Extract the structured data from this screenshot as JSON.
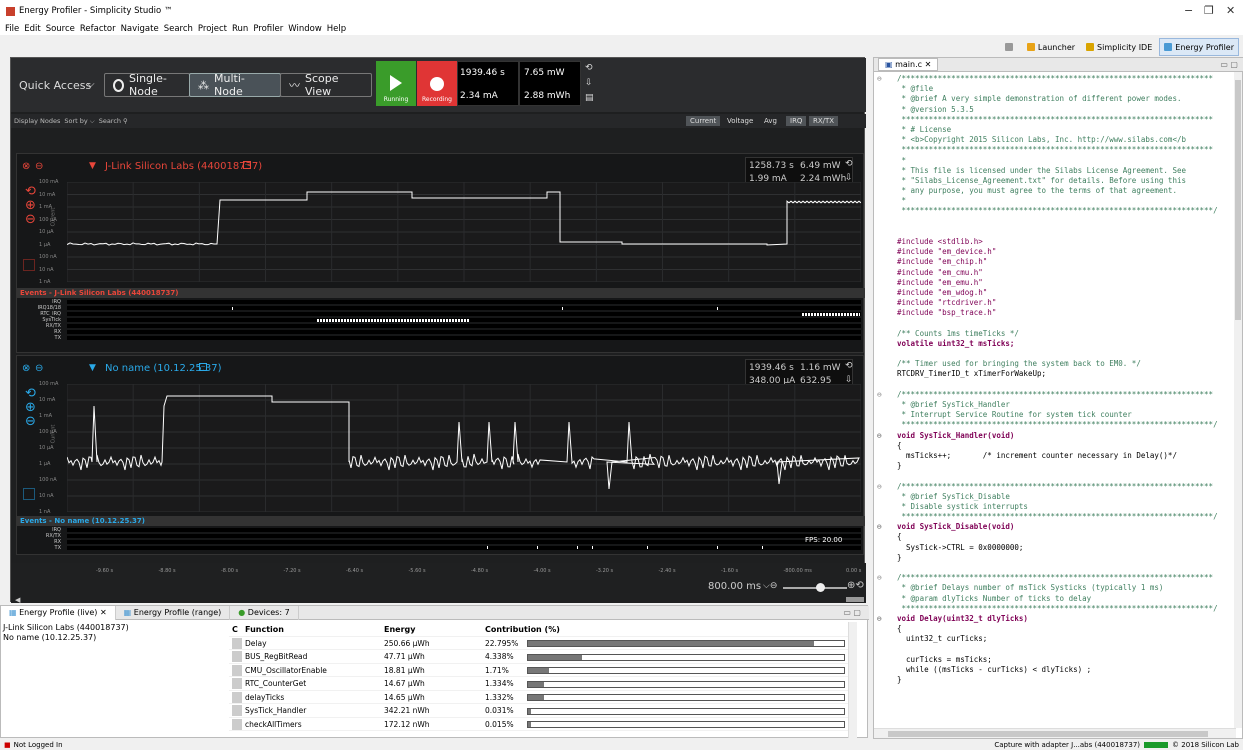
{
  "window": {
    "title": "Energy Profiler - Simplicity Studio ™",
    "min": "−",
    "max": "❐",
    "close": "✕"
  },
  "menu": [
    "File",
    "Edit",
    "Source",
    "Refactor",
    "Navigate",
    "Search",
    "Project",
    "Run",
    "Profiler",
    "Window",
    "Help"
  ],
  "perspectives": {
    "launcher": "Launcher",
    "ide": "Simplicity IDE",
    "profiler": "Energy Profiler"
  },
  "quick_access": {
    "label": "Quick Access",
    "single": "Single-Node",
    "multi": "Multi-Node",
    "scope": "Scope View"
  },
  "run": {
    "running": "Running",
    "recording": "Recording"
  },
  "stats": {
    "time": "1939.46 s",
    "current": "2.34 mA",
    "power": "7.65 mW",
    "energy": "2.88 mWh"
  },
  "filter": {
    "display": "Display Nodes",
    "sort": "Sort by",
    "search": "Search",
    "current": "Current",
    "voltage": "Voltage",
    "avg": "Avg",
    "irq": "IRQ",
    "rxtx": "RX/TX"
  },
  "node1": {
    "name": "J-Link Silicon Labs (440018737)",
    "time": "1258.73 s",
    "current": "1.99 mA",
    "power": "6.49 mW",
    "energy": "2.24 mWh",
    "events_label": "Events - J-Link Silicon Labs (440018737)",
    "ylabels": [
      "100 mA",
      "10 mA",
      "1 mA",
      "100 μA",
      "10 μA",
      "1 μA",
      "100 nA",
      "10 nA",
      "1 nA"
    ],
    "ytitle": "Current",
    "evlabels": [
      "IRQ",
      "IRQ18/18",
      "RTC_IRQ",
      "SysTick",
      "RX/TX",
      "RX",
      "TX"
    ]
  },
  "node2": {
    "name": "No name (10.12.25.37)",
    "time": "1939.46 s",
    "current": "348.00 μA",
    "power": "1.16 mW",
    "energy": "632.95 μWh",
    "events_label": "Events - No name (10.12.25.37)",
    "ylabels": [
      "100 mA",
      "10 mA",
      "1 mA",
      "100 μA",
      "10 μA",
      "1 μA",
      "100 nA",
      "10 nA",
      "1 nA"
    ],
    "ytitle": "Current",
    "evlabels": [
      "IRQ",
      "RX/TX",
      "RX",
      "TX"
    ],
    "fps": "FPS: 20.00"
  },
  "timeaxis": {
    "ticks": [
      "-9.60 s",
      "-8.80 s",
      "-8.00 s",
      "-7.20 s",
      "-6.40 s",
      "-5.60 s",
      "-4.80 s",
      "-4.00 s",
      "-3.20 s",
      "-2.40 s",
      "-1.60 s",
      "-800.00 ms",
      "0.00 s"
    ],
    "zoom": "800.00 ms"
  },
  "bottom": {
    "tab_live": "Energy Profile (live)",
    "tab_range": "Energy Profile (range)",
    "tab_devices": "Devices: 7",
    "devices": [
      "J-Link Silicon Labs (440018737)",
      "No name (10.12.25.37)"
    ],
    "headers": {
      "c": "C",
      "function": "Function",
      "energy": "Energy",
      "contribution": "Contribution (%)"
    },
    "rows": [
      {
        "fn": "Delay",
        "energy": "250.66 μWh",
        "pct": "22.795%",
        "frac": 0.228
      },
      {
        "fn": "BUS_RegBitRead",
        "energy": "47.71 μWh",
        "pct": "4.338%",
        "frac": 0.043
      },
      {
        "fn": "CMU_OscillatorEnable",
        "energy": "18.81 μWh",
        "pct": "1.71%",
        "frac": 0.017
      },
      {
        "fn": "RTC_CounterGet",
        "energy": "14.67 μWh",
        "pct": "1.334%",
        "frac": 0.013
      },
      {
        "fn": "delayTicks",
        "energy": "14.65 μWh",
        "pct": "1.332%",
        "frac": 0.013
      },
      {
        "fn": "SysTick_Handler",
        "energy": "342.21 nWh",
        "pct": "0.031%",
        "frac": 0.0003
      },
      {
        "fn": "checkAllTimers",
        "energy": "172.12 nWh",
        "pct": "0.015%",
        "frac": 0.00015
      }
    ]
  },
  "editor": {
    "tab": "main.c",
    "lines": [
      {
        "t": "/*********************************************************************",
        "c": "cm",
        "f": "⊖"
      },
      {
        "t": " * @file",
        "c": "cm"
      },
      {
        "t": " * @brief A very simple demonstration of different power modes.",
        "c": "cm"
      },
      {
        "t": " * @version 5.3.5",
        "c": "cm"
      },
      {
        "t": " *********************************************************************",
        "c": "cm"
      },
      {
        "t": " * # License",
        "c": "cm"
      },
      {
        "t": " * <b>Copyright 2015 Silicon Labs, Inc. http://www.silabs.com</b",
        "c": "cm"
      },
      {
        "t": " *********************************************************************",
        "c": "cm"
      },
      {
        "t": " *",
        "c": "cm"
      },
      {
        "t": " * This file is licensed under the Silabs License Agreement. See",
        "c": "cm"
      },
      {
        "t": " * \"Silabs_License_Agreement.txt\" for details. Before using this",
        "c": "cm"
      },
      {
        "t": " * any purpose, you must agree to the terms of that agreement.",
        "c": "cm"
      },
      {
        "t": " *",
        "c": "cm"
      },
      {
        "t": " *********************************************************************/",
        "c": "cm"
      },
      {
        "t": "",
        "c": ""
      },
      {
        "t": "",
        "c": ""
      },
      {
        "t": "#include <stdlib.h>",
        "c": "pp"
      },
      {
        "t": "#include \"em_device.h\"",
        "c": "pp"
      },
      {
        "t": "#include \"em_chip.h\"",
        "c": "pp"
      },
      {
        "t": "#include \"em_cmu.h\"",
        "c": "pp"
      },
      {
        "t": "#include \"em_emu.h\"",
        "c": "pp"
      },
      {
        "t": "#include \"em_wdog.h\"",
        "c": "pp"
      },
      {
        "t": "#include \"rtcdriver.h\"",
        "c": "pp"
      },
      {
        "t": "#include \"bsp_trace.h\"",
        "c": "pp"
      },
      {
        "t": "",
        "c": ""
      },
      {
        "t": "/** Counts 1ms timeTicks */",
        "c": "cm"
      },
      {
        "t": "volatile uint32_t msTicks;",
        "c": "kw"
      },
      {
        "t": "",
        "c": ""
      },
      {
        "t": "/** Timer used for bringing the system back to EM0. */",
        "c": "cm"
      },
      {
        "t": "RTCDRV_TimerID_t xTimerForWakeUp;",
        "c": ""
      },
      {
        "t": "",
        "c": ""
      },
      {
        "t": "/*********************************************************************",
        "c": "cm",
        "f": "⊖"
      },
      {
        "t": " * @brief SysTick_Handler",
        "c": "cm"
      },
      {
        "t": " * Interrupt Service Routine for system tick counter",
        "c": "cm"
      },
      {
        "t": " *********************************************************************/",
        "c": "cm"
      },
      {
        "t": "void SysTick_Handler(void)",
        "c": "kw",
        "f": "⊖"
      },
      {
        "t": "{",
        "c": ""
      },
      {
        "t": "  msTicks++;       /* increment counter necessary in Delay()*/",
        "c": ""
      },
      {
        "t": "}",
        "c": ""
      },
      {
        "t": "",
        "c": ""
      },
      {
        "t": "/*********************************************************************",
        "c": "cm",
        "f": "⊖"
      },
      {
        "t": " * @brief SysTick_Disable",
        "c": "cm"
      },
      {
        "t": " * Disable systick interrupts",
        "c": "cm"
      },
      {
        "t": " *********************************************************************/",
        "c": "cm"
      },
      {
        "t": "void SysTick_Disable(void)",
        "c": "kw",
        "f": "⊖"
      },
      {
        "t": "{",
        "c": ""
      },
      {
        "t": "  SysTick->CTRL = 0x0000000;",
        "c": ""
      },
      {
        "t": "}",
        "c": ""
      },
      {
        "t": "",
        "c": ""
      },
      {
        "t": "/*********************************************************************",
        "c": "cm",
        "f": "⊖"
      },
      {
        "t": " * @brief Delays number of msTick Systicks (typically 1 ms)",
        "c": "cm"
      },
      {
        "t": " * @param dlyTicks Number of ticks to delay",
        "c": "cm"
      },
      {
        "t": " *********************************************************************/",
        "c": "cm"
      },
      {
        "t": "void Delay(uint32_t dlyTicks)",
        "c": "kw",
        "f": "⊖"
      },
      {
        "t": "{",
        "c": ""
      },
      {
        "t": "  uint32_t curTicks;",
        "c": ""
      },
      {
        "t": "",
        "c": ""
      },
      {
        "t": "  curTicks = msTicks;",
        "c": ""
      },
      {
        "t": "  while ((msTicks - curTicks) < dlyTicks) ;",
        "c": ""
      },
      {
        "t": "}",
        "c": ""
      }
    ]
  },
  "status": {
    "login": "Not Logged In",
    "capture": "Capture with adapter J...abs (440018737)",
    "copyright": "© 2018 Silicon Lab"
  },
  "colors": {
    "node1": "#e8463a",
    "node2": "#2aa9e8",
    "run": "#3a9c2a",
    "rec": "#e03535"
  }
}
